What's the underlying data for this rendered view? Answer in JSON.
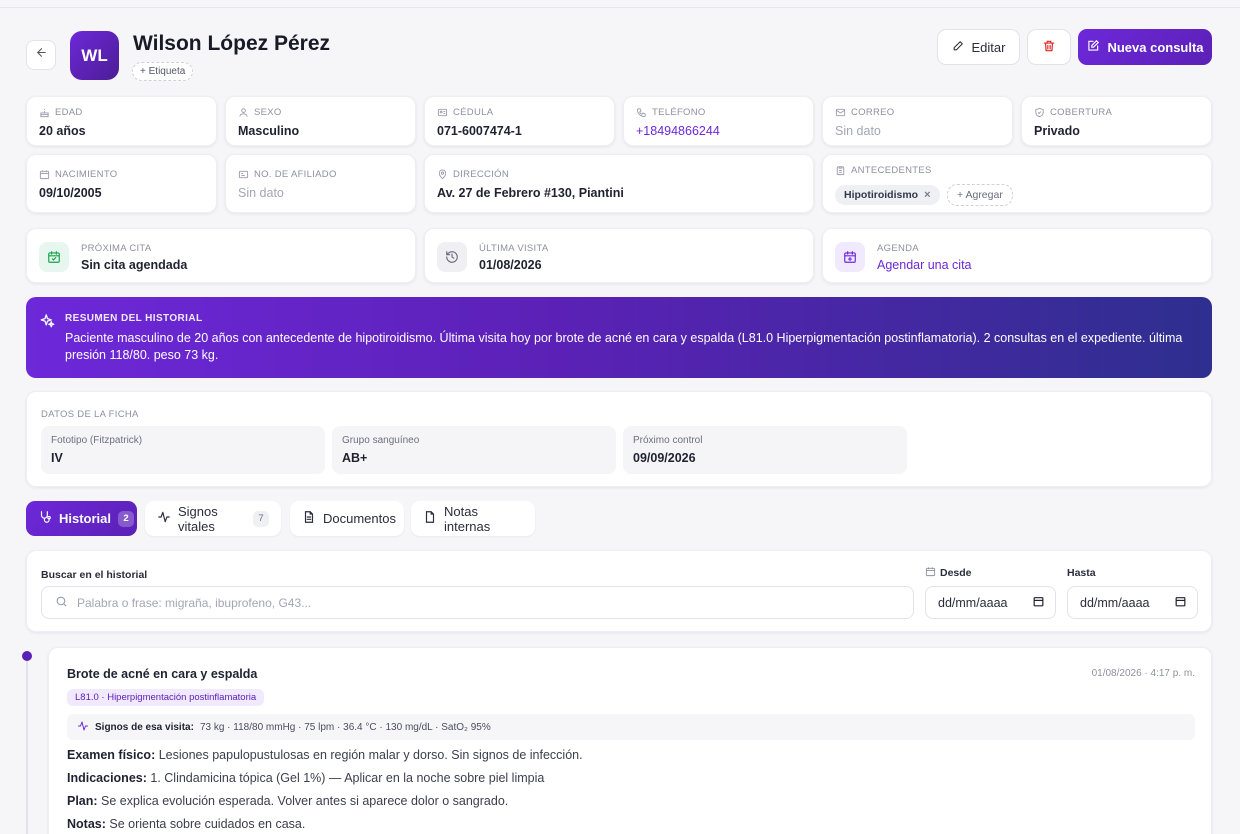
{
  "patient": {
    "initials": "WL",
    "name": "Wilson López Pérez",
    "tag_button": "+ Etiqueta"
  },
  "header_actions": {
    "edit_label": "Editar",
    "new_consult_label": "Nueva consulta"
  },
  "info": {
    "edad": {
      "label": "EDAD",
      "value": "20 años"
    },
    "sexo": {
      "label": "SEXO",
      "value": "Masculino"
    },
    "cedula": {
      "label": "CÉDULA",
      "value": "071-6007474-1"
    },
    "telefono": {
      "label": "TELÉFONO",
      "value": "+18494866244"
    },
    "correo": {
      "label": "CORREO",
      "value": "Sin dato"
    },
    "cobertura": {
      "label": "COBERTURA",
      "value": "Privado"
    },
    "nacimiento": {
      "label": "NACIMIENTO",
      "value": "09/10/2005"
    },
    "afiliado": {
      "label": "NO. DE AFILIADO",
      "value": "Sin dato"
    },
    "direccion": {
      "label": "DIRECCIÓN",
      "value": "Av. 27 de Febrero #130, Piantini"
    },
    "antecedentes": {
      "label": "ANTECEDENTES",
      "items": [
        "Hipotiroidismo"
      ],
      "add_label": "+ Agregar"
    }
  },
  "appointments": {
    "proxima": {
      "label": "PRÓXIMA CITA",
      "value": "Sin cita agendada"
    },
    "ultima": {
      "label": "ÚLTIMA VISITA",
      "value": "01/08/2026"
    },
    "agenda": {
      "label": "AGENDA",
      "value": "Agendar una cita"
    }
  },
  "summary": {
    "title": "RESUMEN DEL HISTORIAL",
    "text": "Paciente masculino de 20 años con antecedente de hipotiroidismo. Última visita hoy por brote de acné en cara y espalda (L81.0 Hiperpigmentación postinflamatoria). 2 consultas en el expediente. última presión 118/80. peso 73 kg."
  },
  "ficha": {
    "title": "DATOS DE LA FICHA",
    "fields": [
      {
        "label": "Fototipo (Fitzpatrick)",
        "value": "IV"
      },
      {
        "label": "Grupo sanguíneo",
        "value": "AB+"
      },
      {
        "label": "Próximo control",
        "value": "09/09/2026"
      }
    ]
  },
  "tabs": [
    {
      "label": "Historial",
      "count": "2"
    },
    {
      "label": "Signos vitales",
      "count": "7"
    },
    {
      "label": "Documentos"
    },
    {
      "label": "Notas internas"
    }
  ],
  "search": {
    "label": "Buscar en el historial",
    "placeholder": "Palabra o frase: migraña, ibuprofeno, G43...",
    "from_label": "Desde",
    "to_label": "Hasta",
    "date_placeholder": "dd/mm/aaaa"
  },
  "entry": {
    "title": "Brote de acné en cara y espalda",
    "datetime": "01/08/2026 · 4:17 p. m.",
    "code": "L81.0 · Hiperpigmentación postinflamatoria",
    "vitals_label": "Signos de esa visita:",
    "vitals_value": "73 kg · 118/80 mmHg · 75 lpm · 36.4 °C · 130 mg/dL · SatO₂ 95%",
    "examen_label": "Examen físico:",
    "examen": "Lesiones papulopustulosas en región malar y dorso. Sin signos de infección.",
    "indicaciones_label": "Indicaciones:",
    "indicaciones": "1. Clindamicina tópica (Gel 1%) — Aplicar en la noche sobre piel limpia",
    "plan_label": "Plan:",
    "plan": "Se explica evolución esperada. Volver antes si aparece dolor o sangrado.",
    "notas_label": "Notas:",
    "notas": "Se orienta sobre cuidados en casa."
  },
  "colors": {
    "accent": "#6d28d9",
    "accent_dark": "#5b21b6",
    "banner_end": "#2e2f8f"
  }
}
